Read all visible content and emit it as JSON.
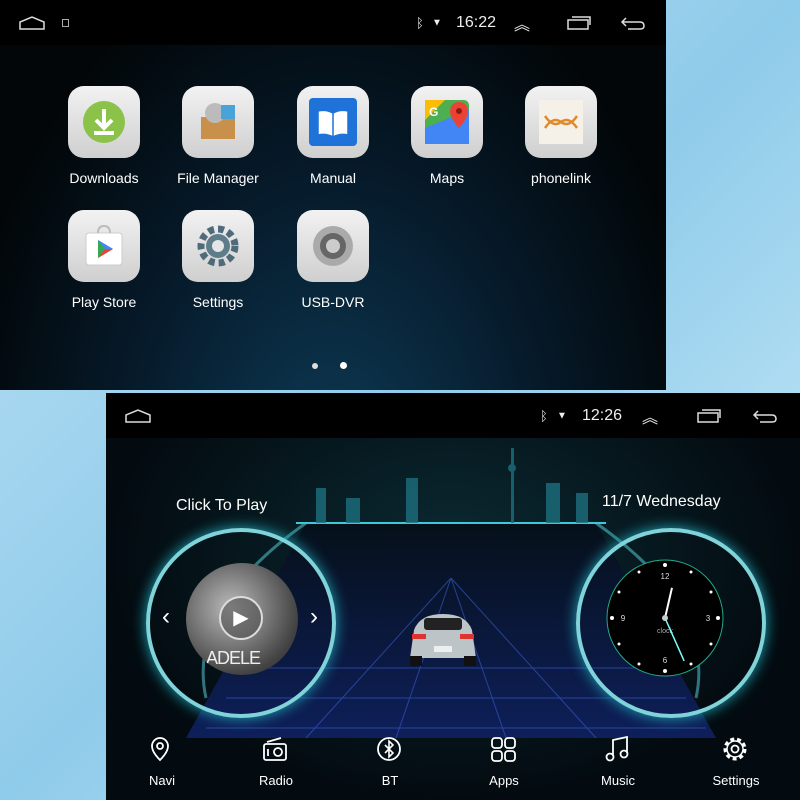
{
  "top_screen": {
    "status": {
      "time": "16:22",
      "icons": [
        "home-icon",
        "notification-icon",
        "bluetooth-icon",
        "wifi-icon",
        "expand-icon",
        "recents-icon",
        "back-icon"
      ]
    },
    "apps": [
      {
        "label": "Downloads"
      },
      {
        "label": "File Manager"
      },
      {
        "label": "Manual"
      },
      {
        "label": "Maps"
      },
      {
        "label": "phonelink"
      },
      {
        "label": "Play Store"
      },
      {
        "label": "Settings"
      },
      {
        "label": "USB-DVR"
      }
    ],
    "page_count": 2,
    "current_page": 2
  },
  "bottom_screen": {
    "status": {
      "time": "12:26"
    },
    "music": {
      "title": "Click To Play",
      "album_text": "ADELE"
    },
    "date": "11/7  Wednesday",
    "clock": {
      "numbers": [
        "12",
        "3",
        "6",
        "9"
      ],
      "label": "clock",
      "hour": 12,
      "minute": 26
    },
    "dock": [
      {
        "label": "Navi"
      },
      {
        "label": "Radio"
      },
      {
        "label": "BT"
      },
      {
        "label": "Apps"
      },
      {
        "label": "Music"
      },
      {
        "label": "Settings"
      }
    ]
  }
}
